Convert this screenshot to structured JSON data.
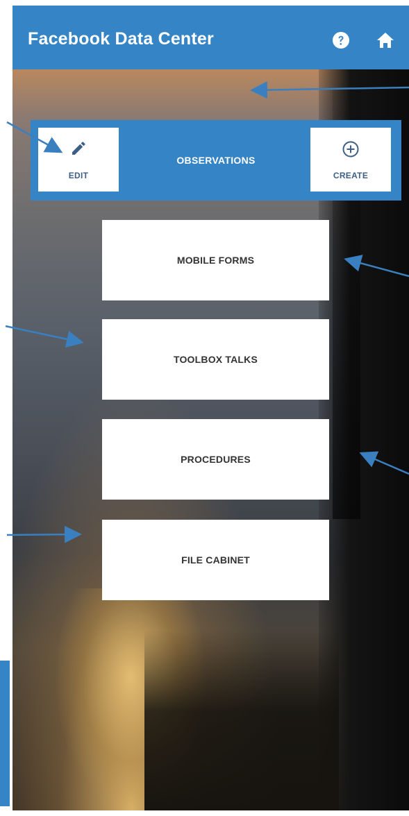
{
  "header": {
    "title": "Facebook Data Center",
    "help_icon": "help-circle-icon",
    "home_icon": "home-icon"
  },
  "observations": {
    "title": "OBSERVATIONS",
    "edit_label": "EDIT",
    "create_label": "CREATE",
    "edit_icon": "pencil-icon",
    "create_icon": "plus-circle-icon"
  },
  "menu": {
    "items": [
      {
        "label": "MOBILE FORMS"
      },
      {
        "label": "TOOLBOX TALKS"
      },
      {
        "label": "PROCEDURES"
      },
      {
        "label": "FILE CABINET"
      }
    ]
  },
  "colors": {
    "primary": "#3585c6",
    "annotation_arrow": "#3a7fbf"
  }
}
